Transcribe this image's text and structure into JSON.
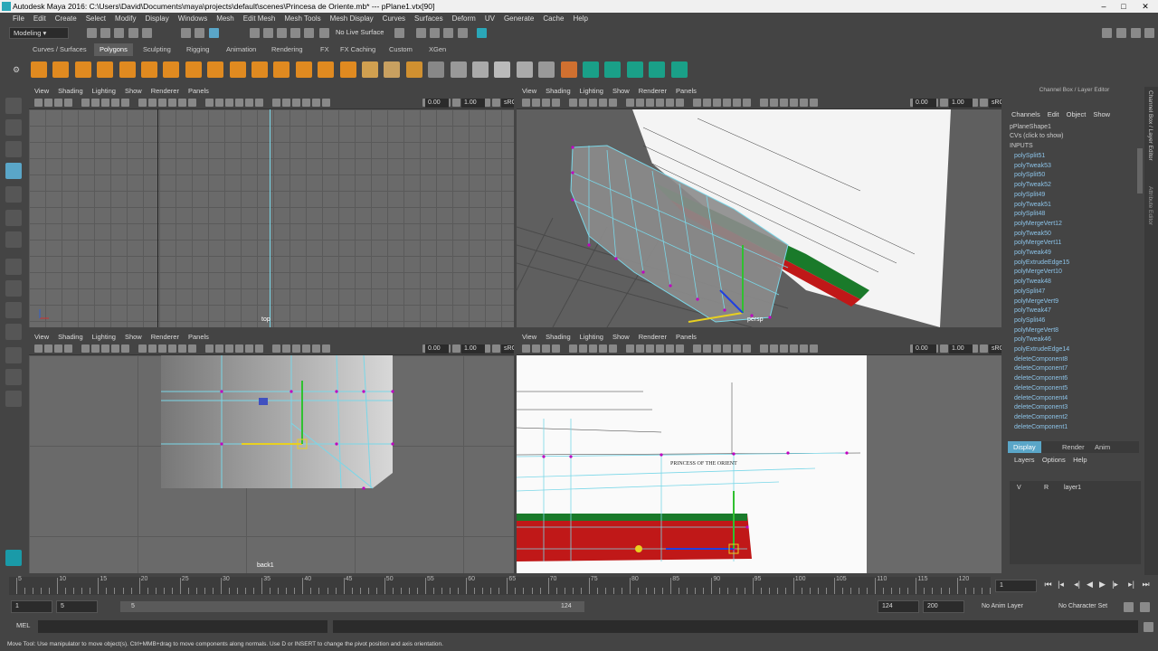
{
  "window": {
    "title": "Autodesk Maya 2016: C:\\Users\\David\\Documents\\maya\\projects\\default\\scenes\\Princesa de Oriente.mb*  ---  pPlane1.vtx[90]",
    "min": "–",
    "max": "□",
    "close": "✕"
  },
  "menu": [
    "File",
    "Edit",
    "Create",
    "Select",
    "Modify",
    "Display",
    "Windows",
    "Mesh",
    "Edit Mesh",
    "Mesh Tools",
    "Mesh Display",
    "Curves",
    "Surfaces",
    "Deform",
    "UV",
    "Generate",
    "Cache",
    "Help"
  ],
  "status": {
    "mode": "Modeling",
    "live_surface": "No Live Surface"
  },
  "shelf_tabs": [
    "Curves / Surfaces",
    "Polygons",
    "Sculpting",
    "Rigging",
    "Animation",
    "Rendering",
    "FX",
    "FX Caching",
    "Custom",
    "XGen"
  ],
  "shelf_active": "Polygons",
  "viewport_menu": [
    "View",
    "Shading",
    "Lighting",
    "Show",
    "Renderer",
    "Panels"
  ],
  "viewport_fields": {
    "exposure": "0.00",
    "gamma": "1.00",
    "colorspace": "sRG"
  },
  "viewports": {
    "top": "top",
    "persp": "persp",
    "back": "back1",
    "front_text": "PRINCESS OF THE ORIENT"
  },
  "channel_box": {
    "header": "Channel Box / Layer Editor",
    "menu": [
      "Channels",
      "Edit",
      "Object",
      "Show"
    ],
    "shape": "pPlaneShape1",
    "cvs": "CVs (click to show)",
    "inputs_label": "INPUTS",
    "inputs": [
      "polySplit51",
      "polyTweak53",
      "polySplit50",
      "polyTweak52",
      "polySplit49",
      "polyTweak51",
      "polySplit48",
      "polyMergeVert12",
      "polyTweak50",
      "polyMergeVert11",
      "polyTweak49",
      "polyExtrudeEdge15",
      "polyMergeVert10",
      "polyTweak48",
      "polySplit47",
      "polyMergeVert9",
      "polyTweak47",
      "polySplit46",
      "polyMergeVert8",
      "polyTweak46",
      "polyExtrudeEdge14",
      "deleteComponent8",
      "deleteComponent7",
      "deleteComponent6",
      "deleteComponent5",
      "deleteComponent4",
      "deleteComponent3",
      "deleteComponent2",
      "deleteComponent1"
    ]
  },
  "layer_editor": {
    "tabs": [
      "Display",
      "Render",
      "Anim"
    ],
    "menu": [
      "Layers",
      "Options",
      "Help"
    ],
    "layer": {
      "v": "V",
      "r": "R",
      "name": "layer1"
    }
  },
  "right_strip": {
    "tab1": "Channel Box / Layer Editor",
    "tab2": "Attribute Editor"
  },
  "timeline": {
    "ticks": [
      "5",
      "10",
      "15",
      "20",
      "25",
      "30",
      "35",
      "40",
      "45",
      "50",
      "55",
      "60",
      "65",
      "70",
      "75",
      "80",
      "85",
      "90",
      "95",
      "100",
      "105",
      "110",
      "115",
      "120"
    ],
    "current": "1"
  },
  "range": {
    "start": "1",
    "play_start": "5",
    "slider_start": "5",
    "slider_end": "124",
    "play_end": "124",
    "end": "200",
    "anim_layer": "No Anim Layer",
    "char_set": "No Character Set"
  },
  "cmd": {
    "label": "MEL"
  },
  "help_line": "Move Tool: Use manipulator to move object(s). Ctrl+MMB+drag to move components along normals. Use D or INSERT to change the pivot position and axis orientation.",
  "colors": {
    "accent": "#5aa6c8",
    "wireframe": "#7ad7e8",
    "vertex": "#c000c0",
    "hull_green": "#1a7a2a",
    "hull_red": "#c01818"
  }
}
